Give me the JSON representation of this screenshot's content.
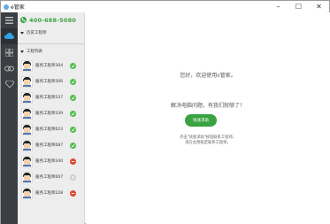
{
  "window": {
    "title": "e管家"
  },
  "sidebar": {
    "phone": "400-688-5080",
    "history_section": "历史工程师",
    "engineers_section": "工程列表",
    "engineers": [
      {
        "name": "服务工程师304",
        "status": "online"
      },
      {
        "name": "服务工程师306",
        "status": "online"
      },
      {
        "name": "服务工程师337",
        "status": "online"
      },
      {
        "name": "服务工程师339",
        "status": "online"
      },
      {
        "name": "服务工程师023",
        "status": "online"
      },
      {
        "name": "服务工程师087",
        "status": "online"
      },
      {
        "name": "服务工程师340",
        "status": "busy"
      },
      {
        "name": "服务工程师007",
        "status": "offline"
      },
      {
        "name": "服务工程师228",
        "status": "busy"
      }
    ]
  },
  "main": {
    "welcome": "您好，欢迎使用e管家。",
    "tagline": "解决电脑问题，有我们就够了！",
    "help_button": "快速求助",
    "hint_line1": "点击\"快速求助\"按钮联系工程师，",
    "hint_line2": "或在左侧指定联系工程师。"
  },
  "colors": {
    "accent": "#3aa341",
    "rail": "#3b3f44",
    "online": "#4cbb4f",
    "busy": "#e0452e",
    "offline": "#c9c9c9"
  },
  "icons": [
    "menu-icon",
    "cloud-icon",
    "grid-icon",
    "link-icon",
    "diamond-icon",
    "phone-icon",
    "minimize-icon",
    "maximize-icon",
    "close-icon"
  ]
}
